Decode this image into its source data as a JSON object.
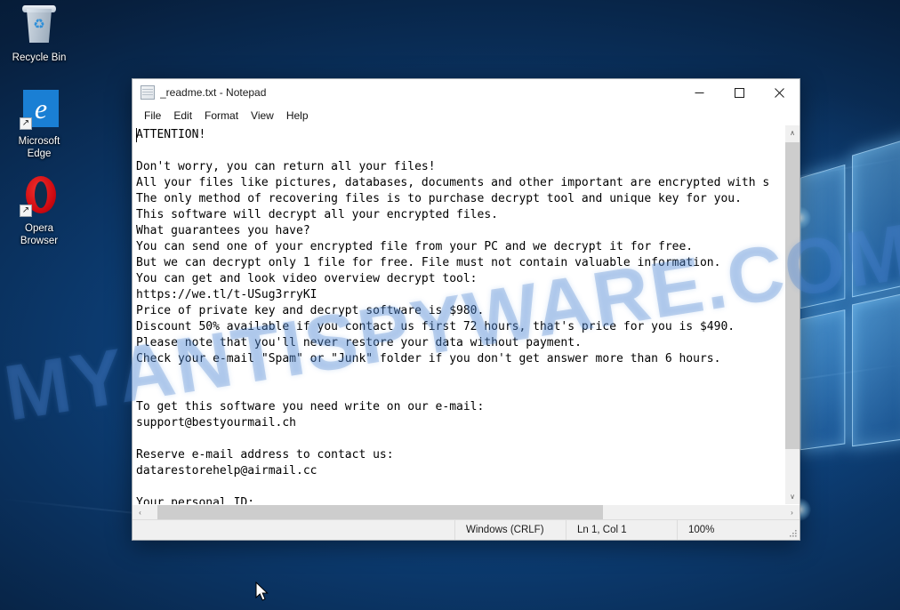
{
  "desktop": {
    "icons": [
      {
        "label": "Recycle Bin",
        "icon": "recycle-bin-icon",
        "shortcut": false
      },
      {
        "label": "Microsoft\nEdge",
        "label_line1": "Microsoft",
        "label_line2": "Edge",
        "icon": "edge-browser-icon",
        "shortcut": true
      },
      {
        "label": "Opera\nBrowser",
        "label_line1": "Opera",
        "label_line2": "Browser",
        "icon": "opera-browser-icon",
        "shortcut": true
      }
    ]
  },
  "watermark": {
    "text": "MYANTISPYWARE.COM"
  },
  "notepad": {
    "title": "_readme.txt - Notepad",
    "icon": "notepad-icon",
    "window_controls": {
      "minimize": "−",
      "maximize": "□",
      "close": "✕"
    },
    "menu": [
      {
        "label": "File"
      },
      {
        "label": "Edit"
      },
      {
        "label": "Format"
      },
      {
        "label": "View"
      },
      {
        "label": "Help"
      }
    ],
    "document": {
      "filename": "_readme.txt",
      "lines": [
        "ATTENTION!",
        "",
        "Don't worry, you can return all your files!",
        "All your files like pictures, databases, documents and other important are encrypted with s",
        "The only method of recovering files is to purchase decrypt tool and unique key for you.",
        "This software will decrypt all your encrypted files.",
        "What guarantees you have?",
        "You can send one of your encrypted file from your PC and we decrypt it for free.",
        "But we can decrypt only 1 file for free. File must not contain valuable information.",
        "You can get and look video overview decrypt tool:",
        "https://we.tl/t-USug3rryKI",
        "Price of private key and decrypt software is $980.",
        "Discount 50% available if you contact us first 72 hours, that's price for you is $490.",
        "Please note that you'll never restore your data without payment.",
        "Check your e-mail \"Spam\" or \"Junk\" folder if you don't get answer more than 6 hours.",
        "",
        "",
        "To get this software you need write on our e-mail:",
        "support@bestyourmail.ch",
        "",
        "Reserve e-mail address to contact us:",
        "datarestorehelp@airmail.cc",
        "",
        "Your personal ID:"
      ],
      "ransom_details": {
        "price_full": "$980",
        "price_discount": "$490",
        "discount_percent": "50%",
        "discount_window_hours": "72 hours",
        "answer_time": "6 hours",
        "video_url": "https://we.tl/t-USug3rryKI",
        "primary_email": "support@bestyourmail.ch",
        "reserve_email": "datarestorehelp@airmail.cc"
      }
    },
    "statusbar": {
      "encoding": "Windows (CRLF)",
      "position": "Ln 1, Col 1",
      "zoom": "100%"
    },
    "scrollbars": {
      "vertical_up": "∧",
      "vertical_down": "∨",
      "horizontal_left": "‹",
      "horizontal_right": "›"
    }
  }
}
